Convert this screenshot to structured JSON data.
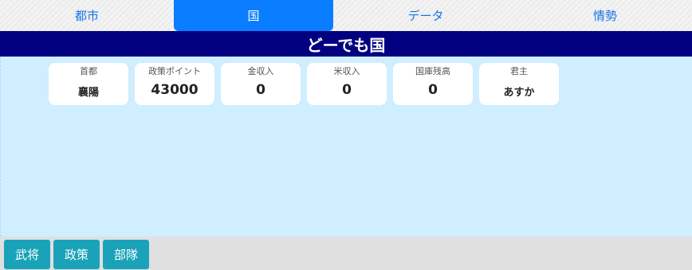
{
  "tabs": [
    {
      "label": "都市"
    },
    {
      "label": "国"
    },
    {
      "label": "データ"
    },
    {
      "label": "情勢"
    }
  ],
  "active_tab": "国",
  "country": {
    "name": "どーでも国"
  },
  "stats": [
    {
      "label": "首都",
      "value": "襄陽"
    },
    {
      "label": "政策ポイント",
      "value": "43000"
    },
    {
      "label": "金収入",
      "value": "0"
    },
    {
      "label": "米収入",
      "value": "0"
    },
    {
      "label": "国庫残高",
      "value": "0"
    },
    {
      "label": "君主",
      "value": "あすか"
    }
  ],
  "bottom_buttons": [
    {
      "label": "武将"
    },
    {
      "label": "政策"
    },
    {
      "label": "部隊"
    }
  ],
  "colors": {
    "active_tab": "#0a7cff",
    "title_band": "#000080",
    "content_bg": "#cfeeff",
    "button": "#1aa3b8"
  }
}
